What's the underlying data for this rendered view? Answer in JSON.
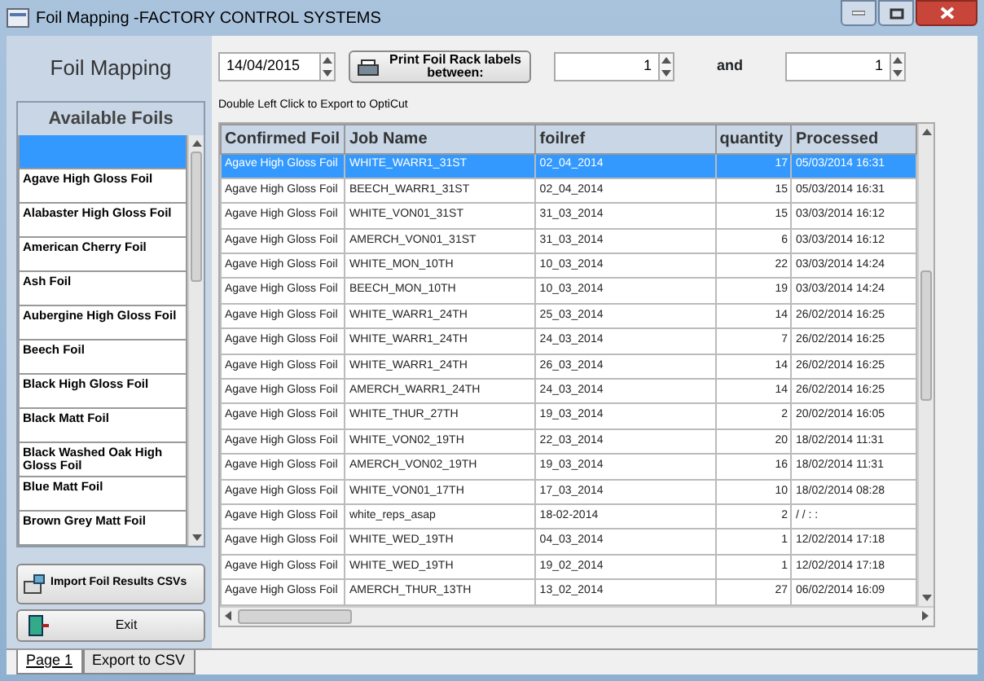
{
  "window": {
    "title": "Foil Mapping -FACTORY CONTROL SYSTEMS"
  },
  "sidebar": {
    "title": "Foil Mapping",
    "foils_title": "Available Foils",
    "foils": [
      {
        "selected": true
      },
      {
        "label": "Agave High Gloss Foil",
        "selected": false
      },
      {
        "label": "Alabaster High Gloss Foil",
        "selected": false
      },
      {
        "label": "American Cherry Foil",
        "selected": false
      },
      {
        "label": "Ash Foil",
        "selected": false
      },
      {
        "label": "Aubergine High Gloss Foil",
        "selected": false
      },
      {
        "label": "Beech Foil",
        "selected": false
      },
      {
        "label": "Black High Gloss Foil",
        "selected": false
      },
      {
        "label": "Black Matt Foil",
        "selected": false
      },
      {
        "label": "Black Washed Oak High Gloss Foil",
        "selected": false
      },
      {
        "label": "Blue Matt Foil",
        "selected": false
      },
      {
        "label": "Brown Grey Matt Foil",
        "selected": false
      }
    ],
    "import_button": "Import Foil Results CSVs",
    "exit_button": "Exit"
  },
  "toolbar": {
    "date": "14/04/2015",
    "print_button": "Print Foil Rack labels between:",
    "range_from": "1",
    "and_label": "and",
    "range_to": "1"
  },
  "hint": "Double Left Click to Export to OptiCut",
  "table": {
    "columns": [
      "Confirmed Foil",
      "Job Name",
      "foilref",
      "quantity",
      "Processed"
    ],
    "rows": [
      {
        "cells": [
          "Agave High Gloss Foil",
          "WHITE_WARR1_31ST",
          "02_04_2014",
          "17",
          "05/03/2014 16:31"
        ],
        "selected": true
      },
      {
        "cells": [
          "Agave High Gloss Foil",
          "BEECH_WARR1_31ST",
          "02_04_2014",
          "15",
          "05/03/2014 16:31"
        ],
        "selected": false
      },
      {
        "cells": [
          "Agave High Gloss Foil",
          "WHITE_VON01_31ST",
          "31_03_2014",
          "15",
          "03/03/2014 16:12"
        ],
        "selected": false
      },
      {
        "cells": [
          "Agave High Gloss Foil",
          "AMERCH_VON01_31ST",
          "31_03_2014",
          "6",
          "03/03/2014 16:12"
        ],
        "selected": false
      },
      {
        "cells": [
          "Agave High Gloss Foil",
          "WHITE_MON_10TH",
          "10_03_2014",
          "22",
          "03/03/2014 14:24"
        ],
        "selected": false
      },
      {
        "cells": [
          "Agave High Gloss Foil",
          "BEECH_MON_10TH",
          "10_03_2014",
          "19",
          "03/03/2014 14:24"
        ],
        "selected": false
      },
      {
        "cells": [
          "Agave High Gloss Foil",
          "WHITE_WARR1_24TH",
          "25_03_2014",
          "14",
          "26/02/2014 16:25"
        ],
        "selected": false
      },
      {
        "cells": [
          "Agave High Gloss Foil",
          "WHITE_WARR1_24TH",
          "24_03_2014",
          "7",
          "26/02/2014 16:25"
        ],
        "selected": false
      },
      {
        "cells": [
          "Agave High Gloss Foil",
          "WHITE_WARR1_24TH",
          "26_03_2014",
          "14",
          "26/02/2014 16:25"
        ],
        "selected": false
      },
      {
        "cells": [
          "Agave High Gloss Foil",
          "AMERCH_WARR1_24TH",
          "24_03_2014",
          "14",
          "26/02/2014 16:25"
        ],
        "selected": false
      },
      {
        "cells": [
          "Agave High Gloss Foil",
          "WHITE_THUR_27TH",
          "19_03_2014",
          "2",
          "20/02/2014 16:05"
        ],
        "selected": false
      },
      {
        "cells": [
          "Agave High Gloss Foil",
          "WHITE_VON02_19TH",
          "22_03_2014",
          "20",
          "18/02/2014 11:31"
        ],
        "selected": false
      },
      {
        "cells": [
          "Agave High Gloss Foil",
          "AMERCH_VON02_19TH",
          "19_03_2014",
          "16",
          "18/02/2014 11:31"
        ],
        "selected": false
      },
      {
        "cells": [
          "Agave High Gloss Foil",
          "WHITE_VON01_17TH",
          "17_03_2014",
          "10",
          "18/02/2014 08:28"
        ],
        "selected": false
      },
      {
        "cells": [
          "Agave High Gloss Foil",
          "white_reps_asap",
          "18-02-2014",
          "2",
          "/ /   : :"
        ],
        "selected": false
      },
      {
        "cells": [
          "Agave High Gloss Foil",
          "WHITE_WED_19TH",
          "04_03_2014",
          "1",
          "12/02/2014 17:18"
        ],
        "selected": false
      },
      {
        "cells": [
          "Agave High Gloss Foil",
          "WHITE_WED_19TH",
          "19_02_2014",
          "1",
          "12/02/2014 17:18"
        ],
        "selected": false
      },
      {
        "cells": [
          "Agave High Gloss Foil",
          "AMERCH_THUR_13TH",
          "13_02_2014",
          "27",
          "06/02/2014 16:09"
        ],
        "selected": false
      }
    ]
  },
  "tabs": [
    {
      "label": "Page 1",
      "selected": true
    },
    {
      "label": "Export to CSV",
      "selected": false
    }
  ]
}
